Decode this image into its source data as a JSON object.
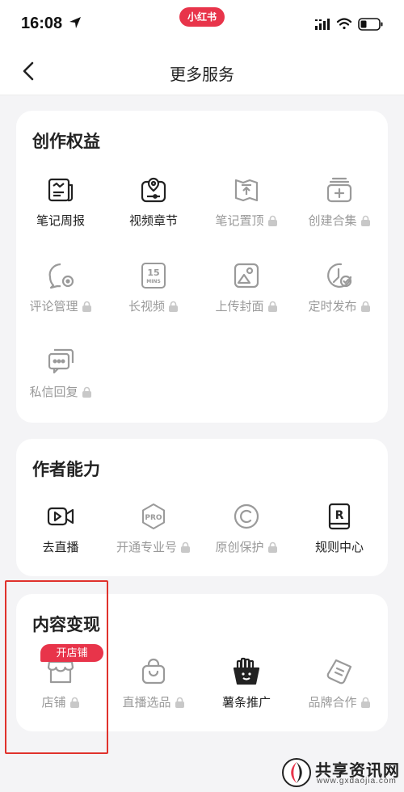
{
  "status_bar": {
    "time": "16:08",
    "app_name": "小红书"
  },
  "nav": {
    "title": "更多服务"
  },
  "sections": [
    {
      "title": "创作权益",
      "items": [
        {
          "label": "笔记周报",
          "icon": "note-report-icon",
          "locked": false
        },
        {
          "label": "视频章节",
          "icon": "video-chapter-icon",
          "locked": false
        },
        {
          "label": "笔记置顶",
          "icon": "pin-top-icon",
          "locked": true
        },
        {
          "label": "创建合集",
          "icon": "create-collection-icon",
          "locked": true
        },
        {
          "label": "评论管理",
          "icon": "comment-manage-icon",
          "locked": true
        },
        {
          "label": "长视频",
          "icon": "long-video-icon",
          "locked": true
        },
        {
          "label": "上传封面",
          "icon": "upload-cover-icon",
          "locked": true
        },
        {
          "label": "定时发布",
          "icon": "scheduled-publish-icon",
          "locked": true
        },
        {
          "label": "私信回复",
          "icon": "message-reply-icon",
          "locked": true
        }
      ]
    },
    {
      "title": "作者能力",
      "items": [
        {
          "label": "去直播",
          "icon": "live-camera-icon",
          "locked": false
        },
        {
          "label": "开通专业号",
          "icon": "pro-account-icon",
          "locked": true
        },
        {
          "label": "原创保护",
          "icon": "copyright-icon",
          "locked": true
        },
        {
          "label": "规则中心",
          "icon": "rules-book-icon",
          "locked": false
        }
      ]
    },
    {
      "title": "内容变现",
      "items": [
        {
          "label": "店铺",
          "icon": "shop-icon",
          "locked": true,
          "badge": "开店铺"
        },
        {
          "label": "直播选品",
          "icon": "shopping-bag-icon",
          "locked": true
        },
        {
          "label": "薯条推广",
          "icon": "fries-promotion-icon",
          "locked": false
        },
        {
          "label": "品牌合作",
          "icon": "brand-cooperation-icon",
          "locked": true
        }
      ]
    }
  ],
  "watermark": {
    "name": "共享资讯网",
    "url": "www.gxdaojia.com"
  },
  "colors": {
    "accent": "#e8344a",
    "highlight_border": "#e0322c",
    "background": "#f4f4f6",
    "active_icon": "#222222",
    "locked_icon": "#9a9a9a"
  }
}
